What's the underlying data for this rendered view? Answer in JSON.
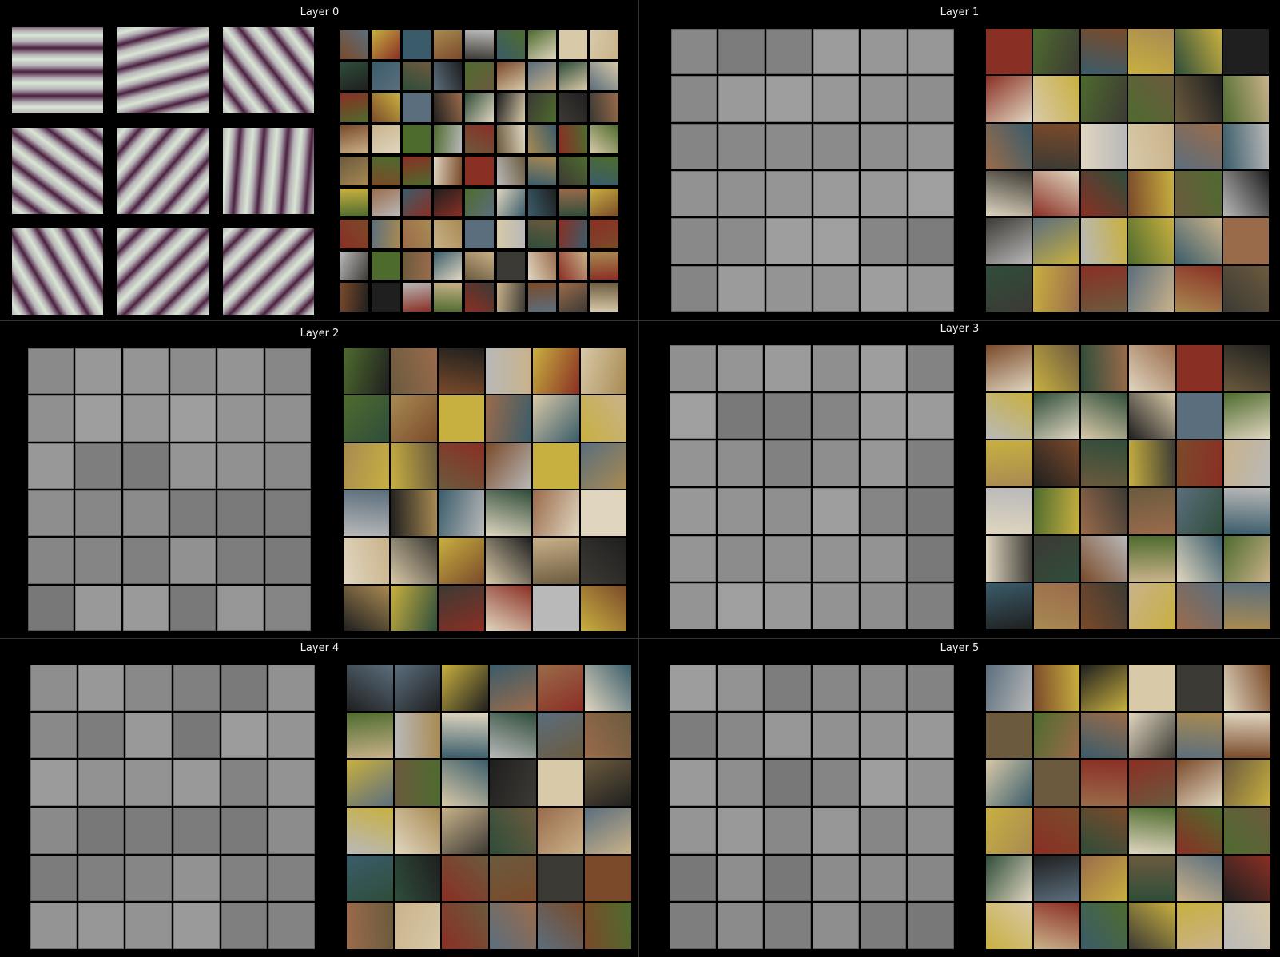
{
  "figure": {
    "panels": [
      {
        "title": "Layer 0",
        "filter_grid": "3x3",
        "patch_grid": "9x9"
      },
      {
        "title": "Layer 1",
        "filter_grid": "6x6",
        "patch_grid": "6x6"
      },
      {
        "title": "Layer 2",
        "filter_grid": "6x6",
        "patch_grid": "6x6"
      },
      {
        "title": "Layer 3",
        "filter_grid": "6x6",
        "patch_grid": "6x6"
      },
      {
        "title": "Layer 4",
        "filter_grid": "6x6",
        "patch_grid": "6x6"
      },
      {
        "title": "Layer 5",
        "filter_grid": "6x6",
        "patch_grid": "6x6"
      }
    ],
    "colors": {
      "background": "#000000",
      "title_text": "#f2f2f2",
      "filter_gray": "#8c8c8c"
    }
  }
}
